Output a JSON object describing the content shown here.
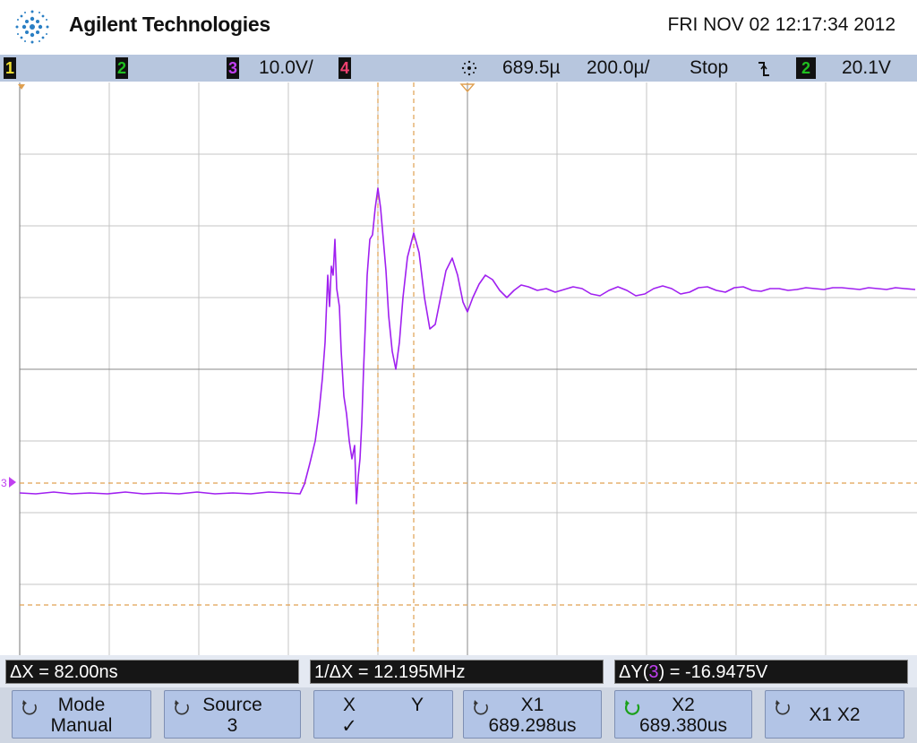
{
  "header": {
    "brand": "Agilent Technologies",
    "datetime": "FRI NOV 02 12:17:34 2012"
  },
  "statusbar": {
    "ch1": "1",
    "ch2": "2",
    "ch3": "3",
    "ch3_scale": "10.0V/",
    "ch4": "4",
    "time_position": "689.5µ",
    "time_scale": "200.0µ/",
    "run_state": "Stop",
    "trigger_source": "2",
    "trigger_level": "20.1V"
  },
  "screen": {
    "ch3_marker": "3"
  },
  "readouts": {
    "delta_x": "ΔX = 82.00ns",
    "inv_delta_x": "1/ΔX = 12.195MHz",
    "delta_y_prefix": "ΔY(",
    "delta_y_channel": "3",
    "delta_y_suffix": ") = -16.9475V"
  },
  "softkeys": {
    "mode_label": "Mode",
    "mode_value": "Manual",
    "source_label": "Source",
    "source_value": "3",
    "x_label": "X",
    "y_label": "Y",
    "check": "✓",
    "x1_label": "X1",
    "x1_value": "689.298us",
    "x2_label": "X2",
    "x2_value": "689.380us",
    "x1x2_label": "X1 X2"
  },
  "colors": {
    "trace": "#a020f0",
    "cursor": "#e0a050",
    "grid": "#b8b8b8",
    "channel1": "#f0e030",
    "channel2": "#20c020",
    "channel3": "#c040f0",
    "channel4": "#f04070"
  }
}
